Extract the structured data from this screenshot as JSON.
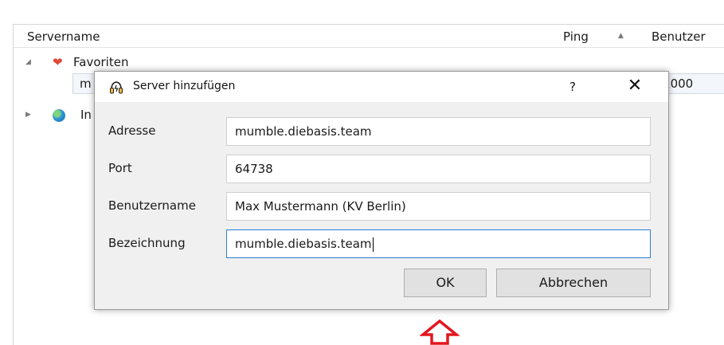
{
  "server_list": {
    "columns": {
      "name": "Servername",
      "ping": "Ping",
      "users": "Benutzer"
    },
    "favorites": {
      "label": "Favoriten",
      "entry": {
        "name_partial": "m",
        "users_partial": "/1000"
      }
    },
    "internet": {
      "label_partial": "In"
    }
  },
  "dialog": {
    "title": "Server hinzufügen",
    "help": "?",
    "close": "✕",
    "fields": [
      {
        "label": "Adresse",
        "value": "mumble.diebasis.team"
      },
      {
        "label": "Port",
        "value": "64738"
      },
      {
        "label": "Benutzername",
        "value": "Max Mustermann (KV Berlin)"
      },
      {
        "label": "Bezeichnung",
        "value": "mumble.diebasis.team"
      }
    ],
    "ok_label": "OK",
    "cancel_label": "Abbrechen"
  },
  "icons": {
    "favorites": "heart-icon",
    "internet": "globe-icon",
    "app": "mumble-icon",
    "annotation": "red-up-arrow-icon"
  },
  "colors": {
    "focus_border": "#2a7fd4",
    "heart": "#e04a3a",
    "annotation_arrow": "#e3161e"
  }
}
